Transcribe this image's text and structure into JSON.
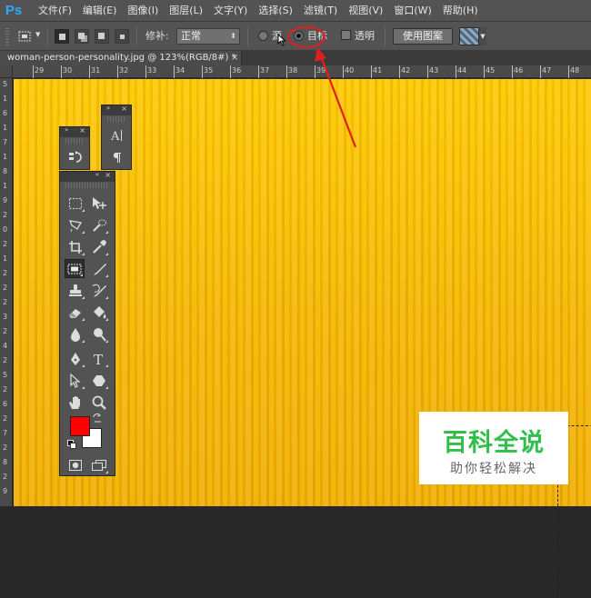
{
  "app": {
    "logo": "Ps"
  },
  "menu": [
    "文件(F)",
    "编辑(E)",
    "图像(I)",
    "图层(L)",
    "文字(Y)",
    "选择(S)",
    "滤镜(T)",
    "视图(V)",
    "窗口(W)",
    "帮助(H)"
  ],
  "options": {
    "patch_label": "修补:",
    "blend_mode": "正常",
    "source_label": "源",
    "target_label": "目标",
    "transparent_label": "透明",
    "use_pattern_label": "使用图案",
    "selected_patch": "target"
  },
  "document": {
    "tab_title": "woman-person-personality.jpg @ 123%(RGB/8#) *",
    "close_glyph": "×"
  },
  "ruler": {
    "h_labels": [
      "29",
      "30",
      "31",
      "32",
      "33",
      "34",
      "35",
      "36",
      "37",
      "38",
      "39",
      "40",
      "41",
      "42",
      "43",
      "44",
      "45",
      "46",
      "47",
      "48"
    ],
    "v_labels": [
      "5",
      "1",
      "6",
      "1",
      "7",
      "1",
      "8",
      "1",
      "9",
      "2",
      "0",
      "2",
      "1",
      "2",
      "2",
      "2",
      "3",
      "2",
      "4",
      "2",
      "5",
      "2",
      "6",
      "2",
      "7",
      "2",
      "8",
      "2",
      "9"
    ]
  },
  "panels": {
    "collapse_glyph": "»",
    "close_glyph": "×"
  },
  "colors": {
    "foreground": "#ff0000",
    "background": "#ffffff",
    "annotation": "#e02020"
  },
  "watermark": {
    "title": "百科全说",
    "subtitle": "助你轻松解决"
  }
}
